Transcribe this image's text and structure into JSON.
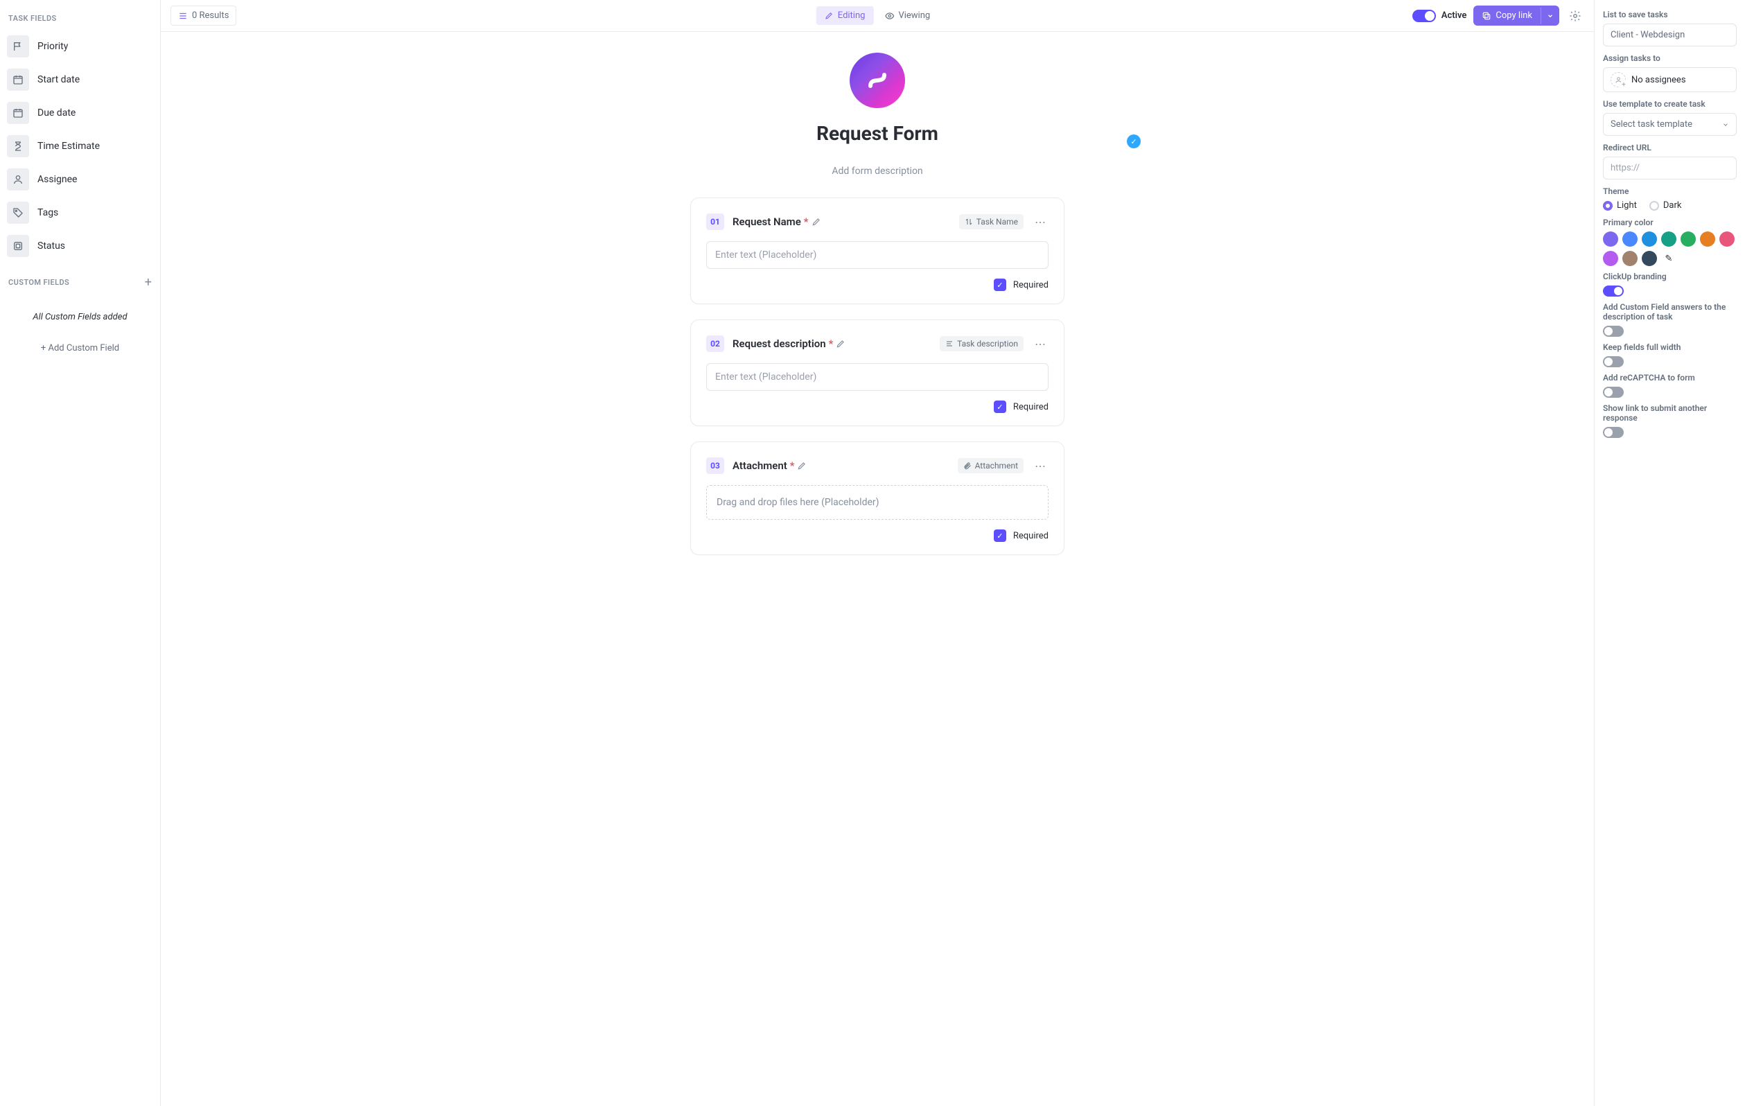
{
  "sidebar": {
    "task_fields_label": "TASK FIELDS",
    "fields": [
      {
        "label": "Priority"
      },
      {
        "label": "Start date"
      },
      {
        "label": "Due date"
      },
      {
        "label": "Time Estimate"
      },
      {
        "label": "Assignee"
      },
      {
        "label": "Tags"
      },
      {
        "label": "Status"
      }
    ],
    "custom_fields_label": "CUSTOM FIELDS",
    "custom_fields_note": "All Custom Fields added",
    "custom_fields_add": "+ Add Custom Field"
  },
  "topbar": {
    "results": "0 Results",
    "editing": "Editing",
    "viewing": "Viewing",
    "active": "Active",
    "copy_link": "Copy link"
  },
  "form": {
    "title": "Request Form",
    "desc_placeholder": "Add form description",
    "blocks": [
      {
        "num": "01",
        "title": "Request Name",
        "tag": "Task Name",
        "input_placeholder": "Enter text (Placeholder)",
        "required_label": "Required",
        "type": "text"
      },
      {
        "num": "02",
        "title": "Request description",
        "tag": "Task description",
        "input_placeholder": "Enter text (Placeholder)",
        "required_label": "Required",
        "type": "text"
      },
      {
        "num": "03",
        "title": "Attachment",
        "tag": "Attachment",
        "input_placeholder": "Drag and drop files here (Placeholder)",
        "required_label": "Required",
        "type": "file"
      }
    ]
  },
  "settings": {
    "list_label": "List to save tasks",
    "list_value": "Client - Webdesign",
    "assign_label": "Assign tasks to",
    "assign_value": "No assignees",
    "template_label": "Use template to create task",
    "template_value": "Select task template",
    "redirect_label": "Redirect URL",
    "redirect_placeholder": "https://",
    "theme_label": "Theme",
    "theme_light": "Light",
    "theme_dark": "Dark",
    "primary_label": "Primary color",
    "colors": [
      "#7b68ee",
      "#4a88ff",
      "#1f8fe0",
      "#16a085",
      "#27ae60",
      "#e67e22",
      "#e8567c",
      "#b45cf0",
      "#a0826d",
      "#34495e"
    ],
    "branding_label": "ClickUp branding",
    "custom_answers_label": "Add Custom Field answers to the description of task",
    "full_width_label": "Keep fields full width",
    "recaptcha_label": "Add reCAPTCHA to form",
    "another_label": "Show link to submit another response"
  }
}
